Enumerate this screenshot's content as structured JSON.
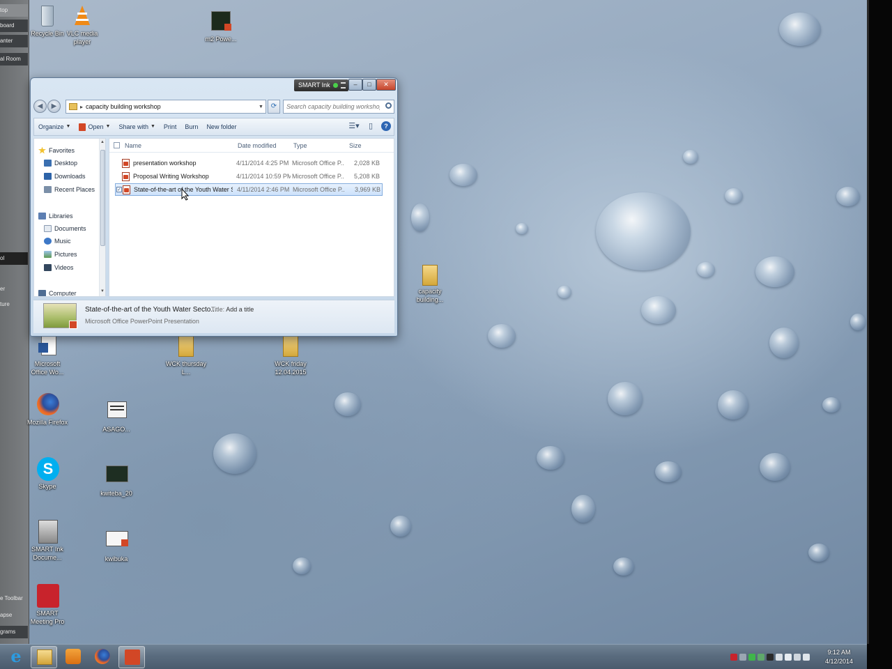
{
  "left_panel": {
    "items": [
      "top",
      "board",
      "anter",
      "al Room",
      "ol",
      "er",
      "ture",
      "e Toolbar",
      "apse",
      "grams"
    ]
  },
  "desktop": {
    "icons": [
      {
        "label": "Recycle Bin"
      },
      {
        "label": "VLC media player"
      },
      {
        "label": "m2 Powe..."
      },
      {
        "label": "capacity building..."
      },
      {
        "label": "Microsoft Office Wo..."
      },
      {
        "label": "WCK thursday L..."
      },
      {
        "label": "WCK friday 12.04.2015"
      },
      {
        "label": "Mozilla Firefox"
      },
      {
        "label": "ASAGO..."
      },
      {
        "label": "Skype"
      },
      {
        "label": "kwiteba_20"
      },
      {
        "label": "SMART Ink Docume..."
      },
      {
        "label": "kwibuka"
      },
      {
        "label": "SMART Meeting Pro"
      }
    ]
  },
  "explorer": {
    "smart_ink_label": "SMART Ink",
    "address_path": "capacity building workshop",
    "search_placeholder": "Search capacity building workshop",
    "toolbar": {
      "organize": "Organize",
      "open": "Open",
      "share_with": "Share with",
      "print": "Print",
      "burn": "Burn",
      "new_folder": "New folder"
    },
    "nav": {
      "favorites": "Favorites",
      "desktop": "Desktop",
      "downloads": "Downloads",
      "recent_places": "Recent Places",
      "libraries": "Libraries",
      "documents": "Documents",
      "music": "Music",
      "pictures": "Pictures",
      "videos": "Videos",
      "computer": "Computer"
    },
    "columns": {
      "name": "Name",
      "date": "Date modified",
      "type": "Type",
      "size": "Size"
    },
    "files": [
      {
        "name": "presentation workshop",
        "date": "4/11/2014 4:25 PM",
        "type": "Microsoft Office P...",
        "size": "2,028 KB",
        "selected": false
      },
      {
        "name": "Proposal Writing Workshop",
        "date": "4/11/2014 10:59 PM",
        "type": "Microsoft Office P...",
        "size": "5,208 KB",
        "selected": false
      },
      {
        "name": "State-of-the-art of the Youth Water Se...",
        "date": "4/11/2014 2:46 PM",
        "type": "Microsoft Office P...",
        "size": "3,969 KB",
        "selected": true
      }
    ],
    "details": {
      "title": "State-of-the-art of the Youth Water Secto...",
      "subtitle": "Microsoft Office PowerPoint Presentation",
      "meta_key": "Title:",
      "meta_value": "Add a title"
    }
  },
  "taskbar": {
    "time": "9:12 AM",
    "date": "4/12/2014"
  }
}
